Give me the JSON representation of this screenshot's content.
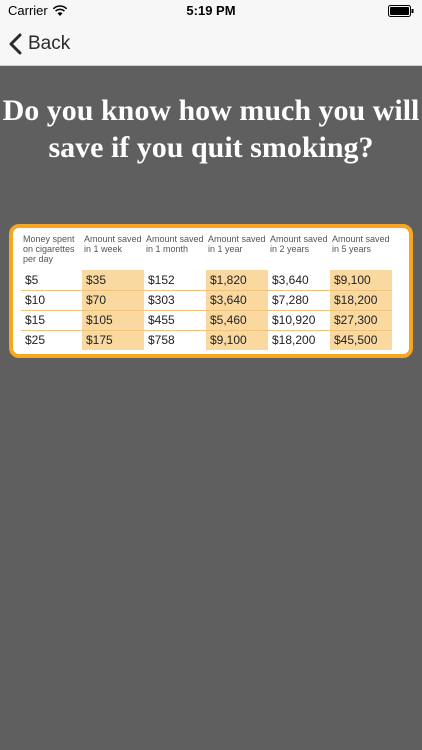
{
  "status": {
    "carrier": "Carrier",
    "time": "5:19 PM"
  },
  "nav": {
    "back_label": "Back"
  },
  "heading": "Do you know how much you will save if you quit smoking?",
  "table": {
    "headers": [
      "Money spent on cigarettes per day",
      "Amount saved in 1 week",
      "Amount saved in 1 month",
      "Amount saved in 1 year",
      "Amount saved in 2 years",
      "Amount saved in 5 years"
    ],
    "rows": [
      [
        "$5",
        "$35",
        "$152",
        "$1,820",
        "$3,640",
        "$9,100"
      ],
      [
        "$10",
        "$70",
        "$303",
        "$3,640",
        "$7,280",
        "$18,200"
      ],
      [
        "$15",
        "$105",
        "$455",
        "$5,460",
        "$10,920",
        "$27,300"
      ],
      [
        "$25",
        "$175",
        "$758",
        "$9,100",
        "$18,200",
        "$45,500"
      ]
    ],
    "highlight_color": "#fad9a1",
    "border_color": "#f5a623"
  },
  "colors": {
    "background": "#5f5f5f",
    "bar": "#f7f7f7"
  }
}
